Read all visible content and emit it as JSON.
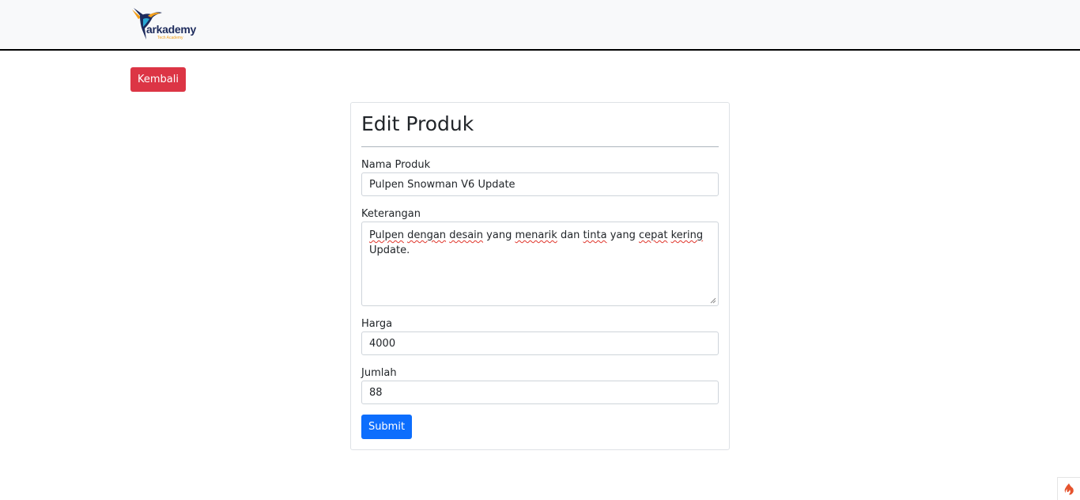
{
  "navbar": {
    "brand_name": "arkademy",
    "brand_tagline": "Tech Academy"
  },
  "back_button": {
    "label": "Kembali"
  },
  "form": {
    "title": "Edit Produk",
    "fields": {
      "nama": {
        "label": "Nama Produk",
        "value": "Pulpen Snowman V6 Update"
      },
      "keterangan": {
        "label": "Keterangan",
        "value_parts": [
          "Pulpen",
          " ",
          "dengan",
          " ",
          "desain",
          " yang ",
          "menarik",
          " dan ",
          "tinta",
          " yang ",
          "cepat",
          " ",
          "kering",
          "Update."
        ]
      },
      "harga": {
        "label": "Harga",
        "value": "4000"
      },
      "jumlah": {
        "label": "Jumlah",
        "value": "88"
      }
    },
    "submit_label": "Submit"
  },
  "colors": {
    "danger": "#dc3545",
    "primary": "#0d6efd",
    "navbar_bg": "#f8f9fa",
    "brand_navy": "#1d2b5c",
    "brand_orange": "#f3a01c"
  },
  "icons": {
    "brand_logo": "hummingbird-logo-icon",
    "corner": "flame-icon"
  }
}
